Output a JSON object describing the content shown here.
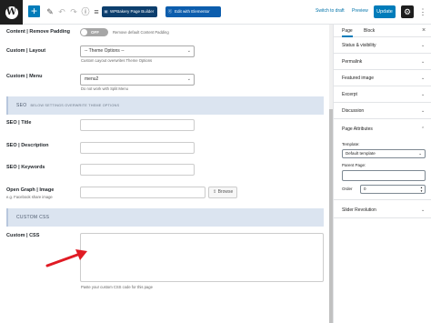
{
  "toolbar": {
    "wp_logo": "W",
    "add_icon": "+",
    "pb_label": "WPBakery Page Builder",
    "elementor_label": "Edit with Elementor",
    "switch_draft": "Switch to draft",
    "preview": "Preview",
    "update": "Update",
    "icons": [
      "edit-icon",
      "undo-icon",
      "redo-icon",
      "info-icon",
      "list-view-icon",
      "gear-icon",
      "more-icon"
    ]
  },
  "main": {
    "content_padding": {
      "label": "Content | Remove Padding",
      "toggle": "OFF",
      "description": "Remove default Content Padding"
    },
    "layout": {
      "label": "Custom | Layout",
      "value": "-- Theme Options --",
      "description": "Custom Layout overwrites Theme Options"
    },
    "menu": {
      "label": "Custom | Menu",
      "value": "menu2",
      "description": "Do not work with Split Menu"
    },
    "seo_section": {
      "title": "SEO",
      "subtitle": "BELOW SETTINGS OVERWRITE THEME OPTIONS"
    },
    "seo_title": {
      "label": "SEO | Title"
    },
    "seo_description": {
      "label": "SEO | Description"
    },
    "seo_keywords": {
      "label": "SEO | Keywords"
    },
    "open_graph": {
      "label": "Open Graph | Image",
      "description": "e.g. Facebook share image",
      "browse": "Browse"
    },
    "css_section": {
      "title": "CUSTOM CSS"
    },
    "custom_css": {
      "label": "Custom | CSS",
      "description": "Paste your custom CSS code for this page"
    }
  },
  "sidebar": {
    "tabs": [
      "Page",
      "Block"
    ],
    "close": "×",
    "panels": [
      "Status & visibility",
      "Permalink",
      "Featured image",
      "Excerpt",
      "Discussion"
    ],
    "page_attributes": {
      "title": "Page Attributes",
      "template_label": "Template:",
      "template_value": "Default template",
      "parent_label": "Parent Page:",
      "order_label": "Order",
      "order_value": "0"
    },
    "slider": "Slider Revolution"
  },
  "colors": {
    "accent": "#007cba",
    "section_bg": "#dbe4f0",
    "pb_button": "#0c3e6d",
    "elementor_button": "#0c5dad",
    "annotation_arrow": "#e01b24"
  }
}
